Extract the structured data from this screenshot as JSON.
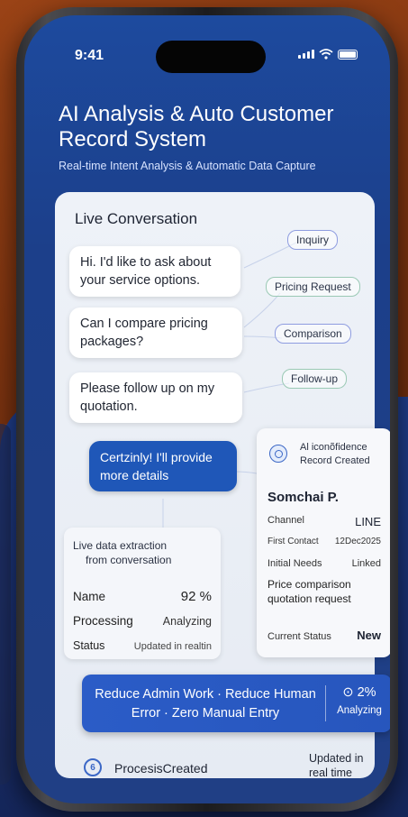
{
  "status_bar": {
    "time": "9:41"
  },
  "header": {
    "title": "AI Analysis & Auto Customer Record System",
    "subtitle": "Real-time Intent Analysis & Automatic Data Capture"
  },
  "conversation": {
    "title": "Live Conversation",
    "messages": [
      "Hi. I'd like to ask about your service options.",
      "Can I compare pricing packages?",
      "Please follow up on my quotation."
    ],
    "reply": "Certzinly! I'll provide more details"
  },
  "intent_tags": [
    "Inquiry",
    "Pricing Request",
    "Comparison",
    "Follow-up"
  ],
  "extraction": {
    "title_line1": "Live data extraction",
    "title_line2": "from conversation",
    "rows": [
      {
        "label": "Name",
        "value": "92 %"
      },
      {
        "label": "Processing",
        "value": "Analyzing"
      },
      {
        "label": "Status",
        "value": "Updated in realtin"
      }
    ]
  },
  "record": {
    "head_line1": "Al iconõfidence",
    "head_line2": "Record Created",
    "name": "Somchai P.",
    "channel_label": "Channel",
    "channel_value": "LINE",
    "first_contact_label": "First Contact",
    "first_contact_value": "12Dec2025",
    "needs_label": "Initial Needs",
    "needs_value": "Linked",
    "needs_text": "Price comparison quotation request",
    "current_status_label": "Current Status",
    "current_status_value": "New"
  },
  "banner": {
    "text": "Reduce Admin Work · Reduce Human Error · Zero Manual Entry",
    "percent": "⊙ 2%",
    "sub": "Analyzing"
  },
  "footer": {
    "icon_glyph": "6",
    "label": "ProcesisCreated",
    "right_text": "Updated in real time"
  },
  "colors": {
    "screen_blue": "#1d4a9e",
    "accent_blue": "#2b5cc7",
    "card_bg": "#eef2f8",
    "background_orange": "#8a3a12"
  }
}
